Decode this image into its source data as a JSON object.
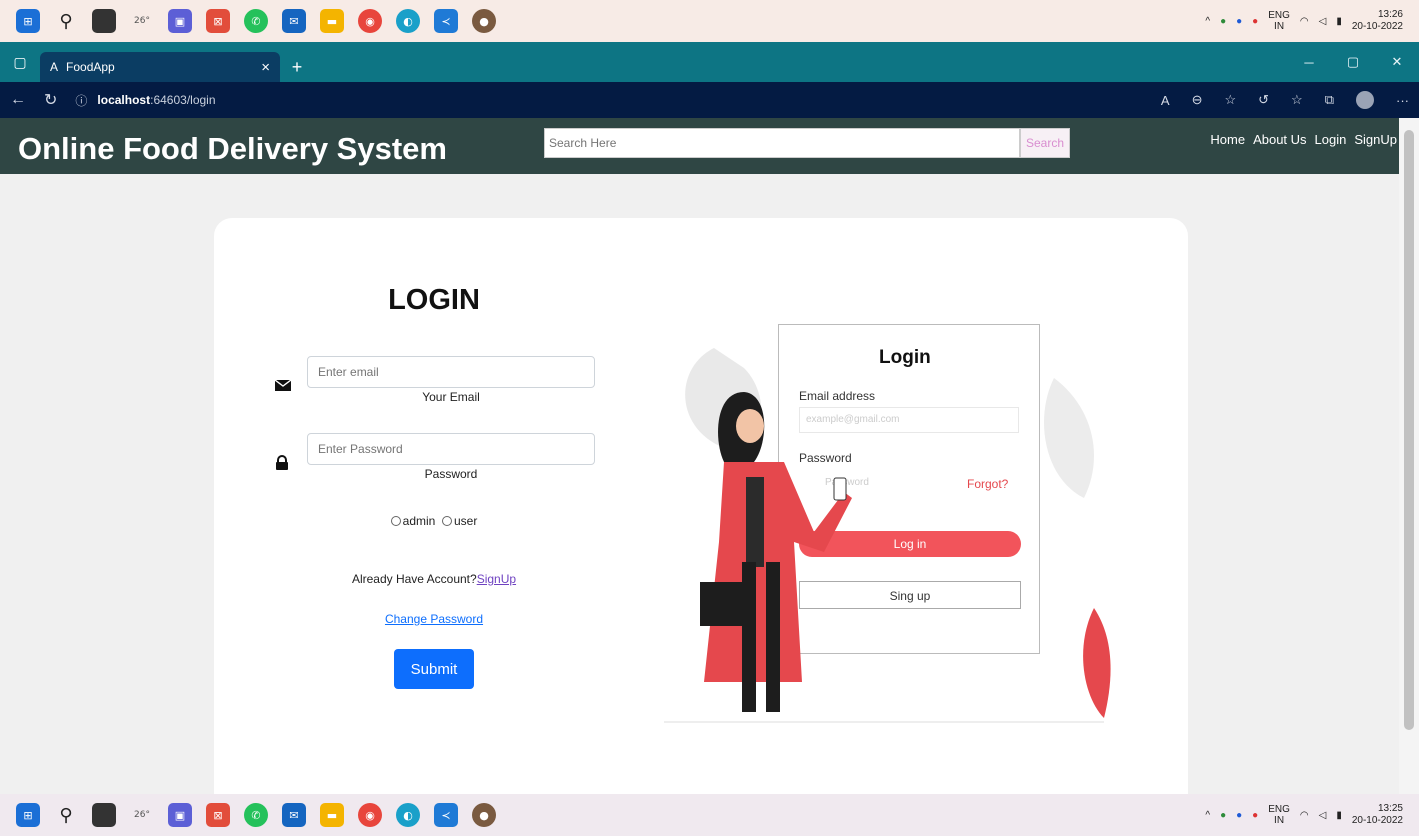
{
  "taskbar": {
    "weather": "26°",
    "lang_top": "ENG",
    "lang_bottom": "IN",
    "time_top": "13:26",
    "date_top": "20-10-2022",
    "time_bottom": "13:25",
    "date_bottom": "20-10-2022"
  },
  "browser": {
    "tab_title": "FoodApp",
    "url_host": "localhost",
    "url_rest": ":64603/login"
  },
  "header": {
    "brand": "Online Food Delivery System",
    "search_placeholder": "Search Here",
    "search_button": "Search",
    "nav": [
      "Home",
      "About Us",
      "Login",
      "SignUp"
    ]
  },
  "form": {
    "title": "LOGIN",
    "email_placeholder": "Enter email",
    "email_label": "Your Email",
    "password_placeholder": "Enter Password",
    "password_label": "Password",
    "radio_admin": "admin",
    "radio_user": "user",
    "already_text": "Already Have Account?",
    "signup_link": "SignUp",
    "change_password": "Change Password",
    "submit": "Submit"
  },
  "illustration": {
    "title": "Login",
    "email_label": "Email address",
    "email_placeholder": "example@gmail.com",
    "password_label": "Password",
    "password_placeholder": "Password",
    "forgot": "Forgot?",
    "login_btn": "Log in",
    "signup_btn": "Sing up"
  },
  "colors": {
    "header_bg": "#2f4644",
    "submit_bg": "#0d6efd",
    "accent_red": "#f2545b"
  }
}
